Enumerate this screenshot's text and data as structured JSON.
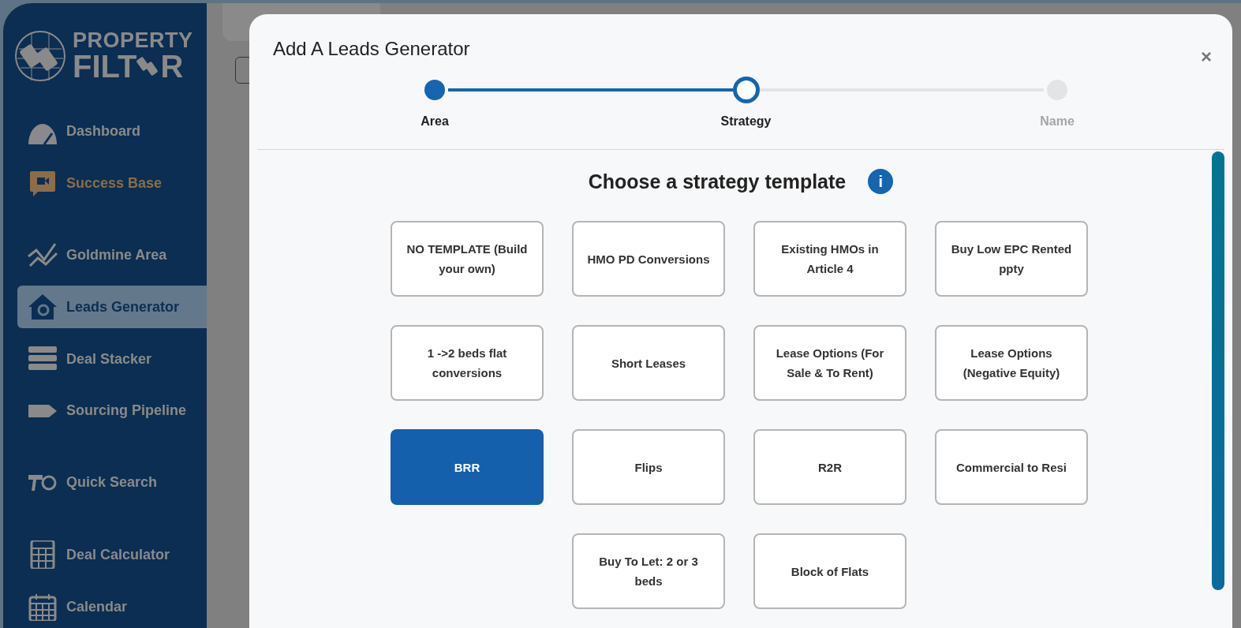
{
  "logo": {
    "line_1": "PROPERTY",
    "line_2_start": "FILT",
    "line_2_end": "R"
  },
  "sidebar": {
    "items": [
      {
        "label": "Dashboard",
        "selected": false,
        "color": "#8a8a8a"
      },
      {
        "label": "Success Base",
        "selected": false,
        "color": "#8c6d47"
      },
      {
        "label": "Goldmine Area",
        "selected": false,
        "color": "#8a8a8a"
      },
      {
        "label": "Leads Generator",
        "selected": true,
        "color": "#0b2e52"
      },
      {
        "label": "Deal Stacker",
        "selected": false,
        "color": "#8a8a8a"
      },
      {
        "label": "Sourcing Pipeline",
        "selected": false,
        "color": "#8a8a8a"
      },
      {
        "label": "Quick Search",
        "selected": false,
        "color": "#8a8a8a"
      },
      {
        "label": "Deal Calculator",
        "selected": false,
        "color": "#8a8a8a"
      },
      {
        "label": "Calendar",
        "selected": false,
        "color": "#8a8a8a"
      }
    ]
  },
  "modal": {
    "title": "Add A Leads Generator",
    "close": "×",
    "steps": [
      {
        "label": "Area",
        "done": true,
        "current": false
      },
      {
        "label": "Strategy",
        "done": false,
        "current": true
      },
      {
        "label": "Name",
        "done": false,
        "current": false
      }
    ],
    "heading": "Choose a strategy template",
    "info": "i",
    "templates": [
      {
        "label": "NO TEMPLATE (Build your own)",
        "selected": false
      },
      {
        "label": "HMO PD Conversions",
        "selected": false
      },
      {
        "label": "Existing HMOs in Article 4",
        "selected": false
      },
      {
        "label": "Buy Low EPC Rented ppty",
        "selected": false
      },
      {
        "label": "1 ->2 beds flat conversions",
        "selected": false
      },
      {
        "label": "Short Leases",
        "selected": false
      },
      {
        "label": "Lease Options (For Sale & To Rent)",
        "selected": false
      },
      {
        "label": "Lease Options (Negative Equity)",
        "selected": false
      },
      {
        "label": "BRR",
        "selected": true
      },
      {
        "label": "Flips",
        "selected": false
      },
      {
        "label": "R2R",
        "selected": false
      },
      {
        "label": "Commercial to Resi",
        "selected": false
      },
      {
        "label": "Buy To Let: 2 or 3 beds",
        "selected": false
      },
      {
        "label": "Block of Flats",
        "selected": false
      }
    ]
  }
}
